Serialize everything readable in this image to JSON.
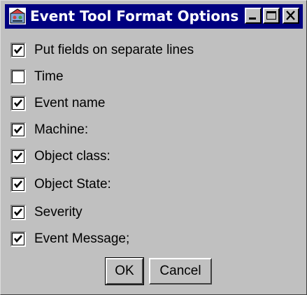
{
  "window": {
    "title": "Event Tool Format Options",
    "title_bar_color": "#000080",
    "face_color": "#c0c0c0",
    "app_icon": "app-icon",
    "controls": {
      "minimize_icon": "minimize-icon",
      "maximize_icon": "maximize-icon",
      "close_icon": "close-icon"
    }
  },
  "options": [
    {
      "label": "Put fields on separate lines",
      "checked": true
    },
    {
      "label": "Time",
      "checked": false
    },
    {
      "label": "Event name",
      "checked": true
    },
    {
      "label": "Machine:",
      "checked": true
    },
    {
      "label": "Object class:",
      "checked": true
    },
    {
      "label": "Object State:",
      "checked": true
    },
    {
      "label": "Severity",
      "checked": true
    },
    {
      "label": "Event Message;",
      "checked": true
    }
  ],
  "buttons": {
    "ok_label": "OK",
    "cancel_label": "Cancel"
  }
}
